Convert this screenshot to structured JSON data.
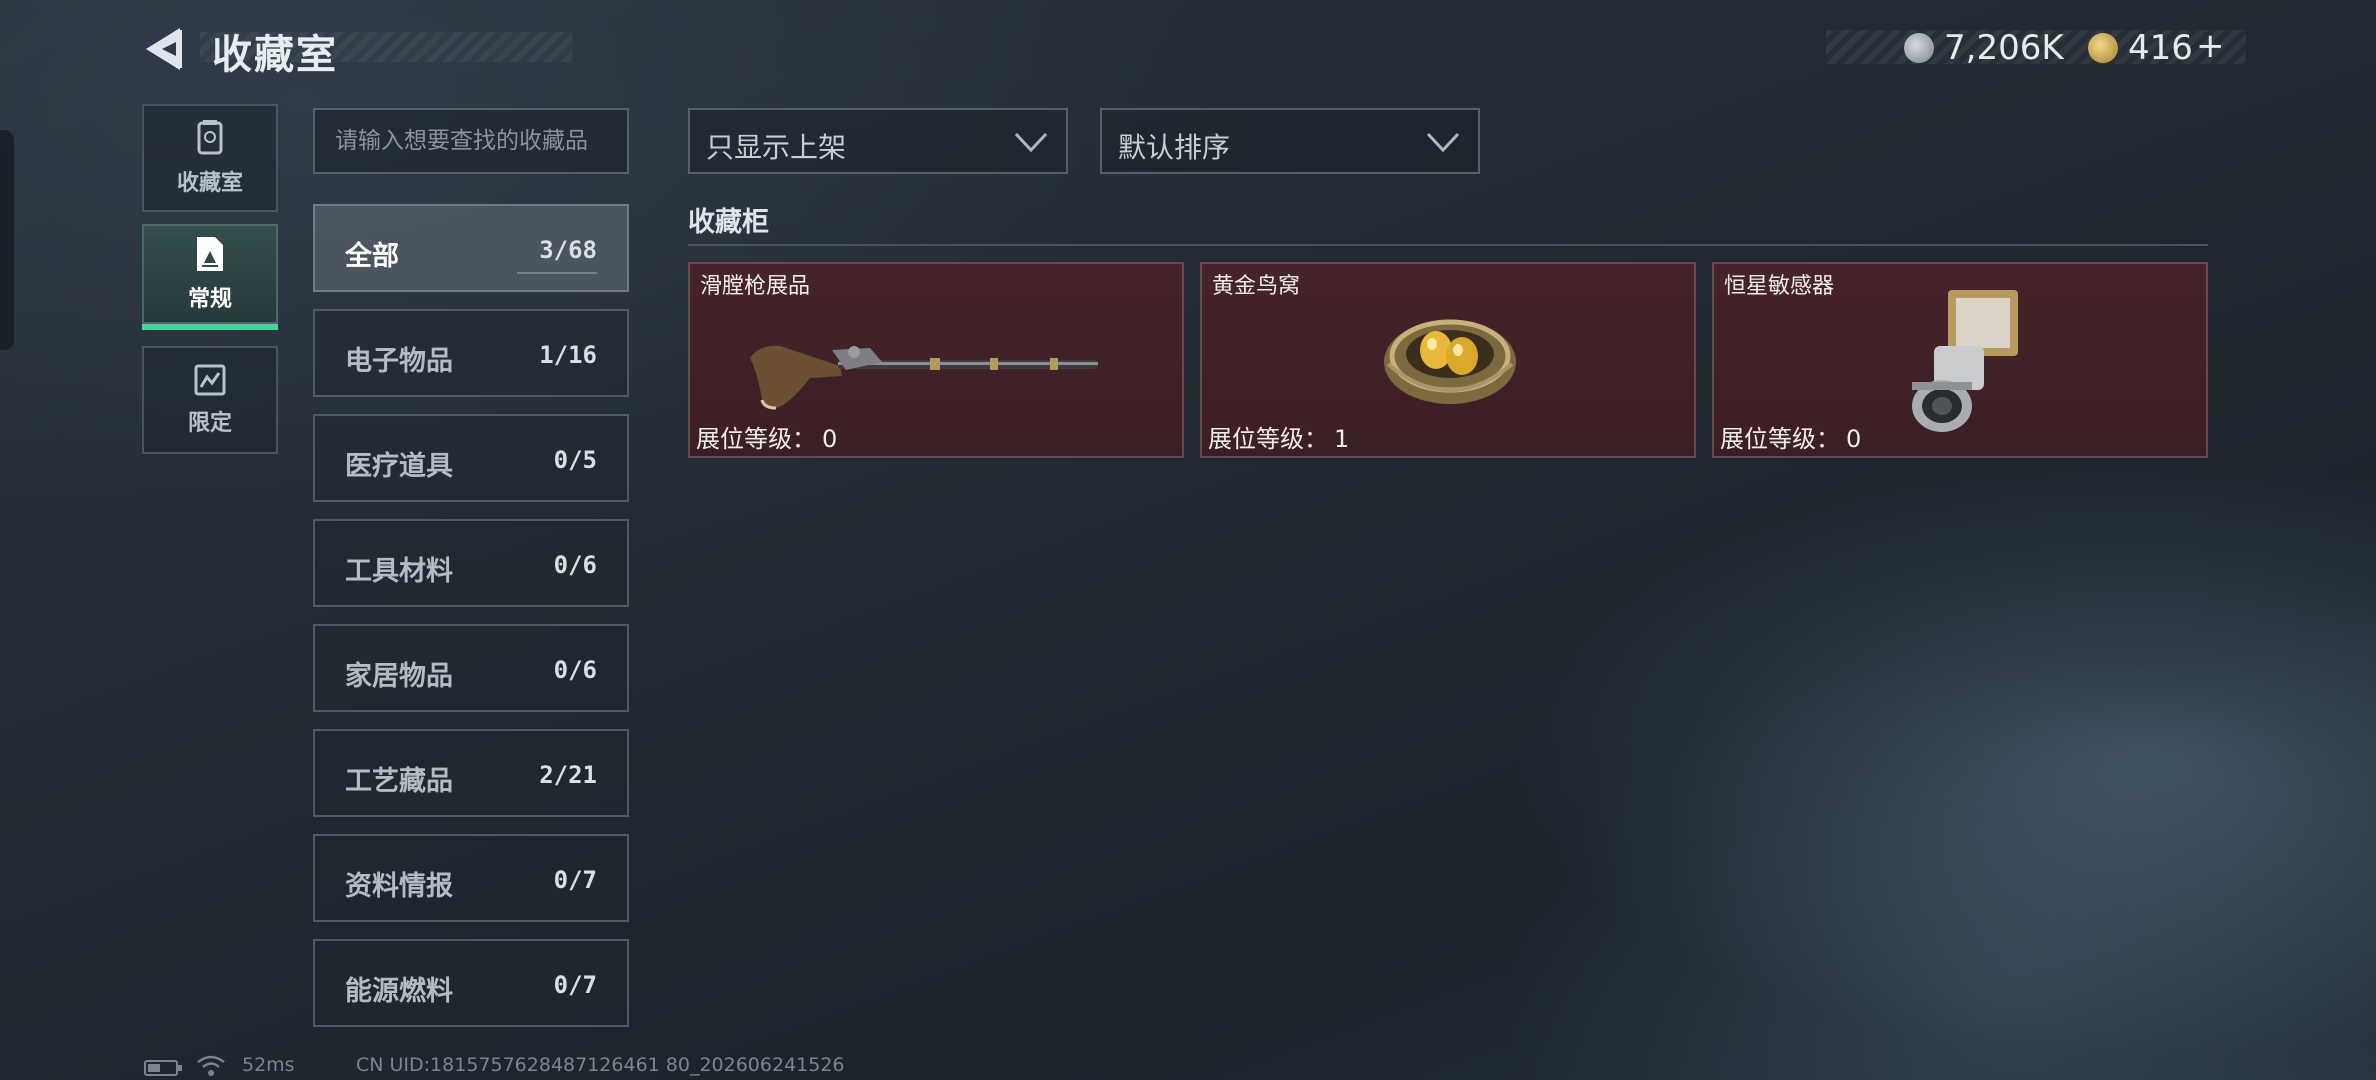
{
  "header": {
    "title": "收藏室",
    "currency_silver": "7,206K",
    "currency_gold": "416",
    "add_label": "+"
  },
  "rail": {
    "items": [
      {
        "label": "收藏室",
        "icon": "collection-room-icon"
      },
      {
        "label": "常规",
        "icon": "regular-icon",
        "active": true
      },
      {
        "label": "限定",
        "icon": "limited-icon"
      }
    ]
  },
  "search": {
    "placeholder": "请输入想要查找的收藏品"
  },
  "categories": [
    {
      "name": "全部",
      "count": "3/68",
      "active": true
    },
    {
      "name": "电子物品",
      "count": "1/16"
    },
    {
      "name": "医疗道具",
      "count": "0/5"
    },
    {
      "name": "工具材料",
      "count": "0/6"
    },
    {
      "name": "家居物品",
      "count": "0/6"
    },
    {
      "name": "工艺藏品",
      "count": "2/21"
    },
    {
      "name": "资料情报",
      "count": "0/7"
    },
    {
      "name": "能源燃料",
      "count": "0/7"
    }
  ],
  "filters": {
    "shelf_filter": "只显示上架",
    "sort_order": "默认排序"
  },
  "cabinet": {
    "title": "收藏柜",
    "level_label": "展位等级：",
    "items": [
      {
        "name": "滑膛枪展品",
        "level": "0",
        "icon": "musket-icon"
      },
      {
        "name": "黄金鸟窝",
        "level": "1",
        "icon": "golden-nest-icon"
      },
      {
        "name": "恒星敏感器",
        "level": "0",
        "icon": "star-sensor-icon"
      }
    ]
  },
  "status": {
    "ping": "52ms",
    "uid": "CN UID:1815757628487126461 80_202606241526"
  },
  "colors": {
    "accent_green": "#47d59b",
    "card_bg": "#45242a"
  }
}
